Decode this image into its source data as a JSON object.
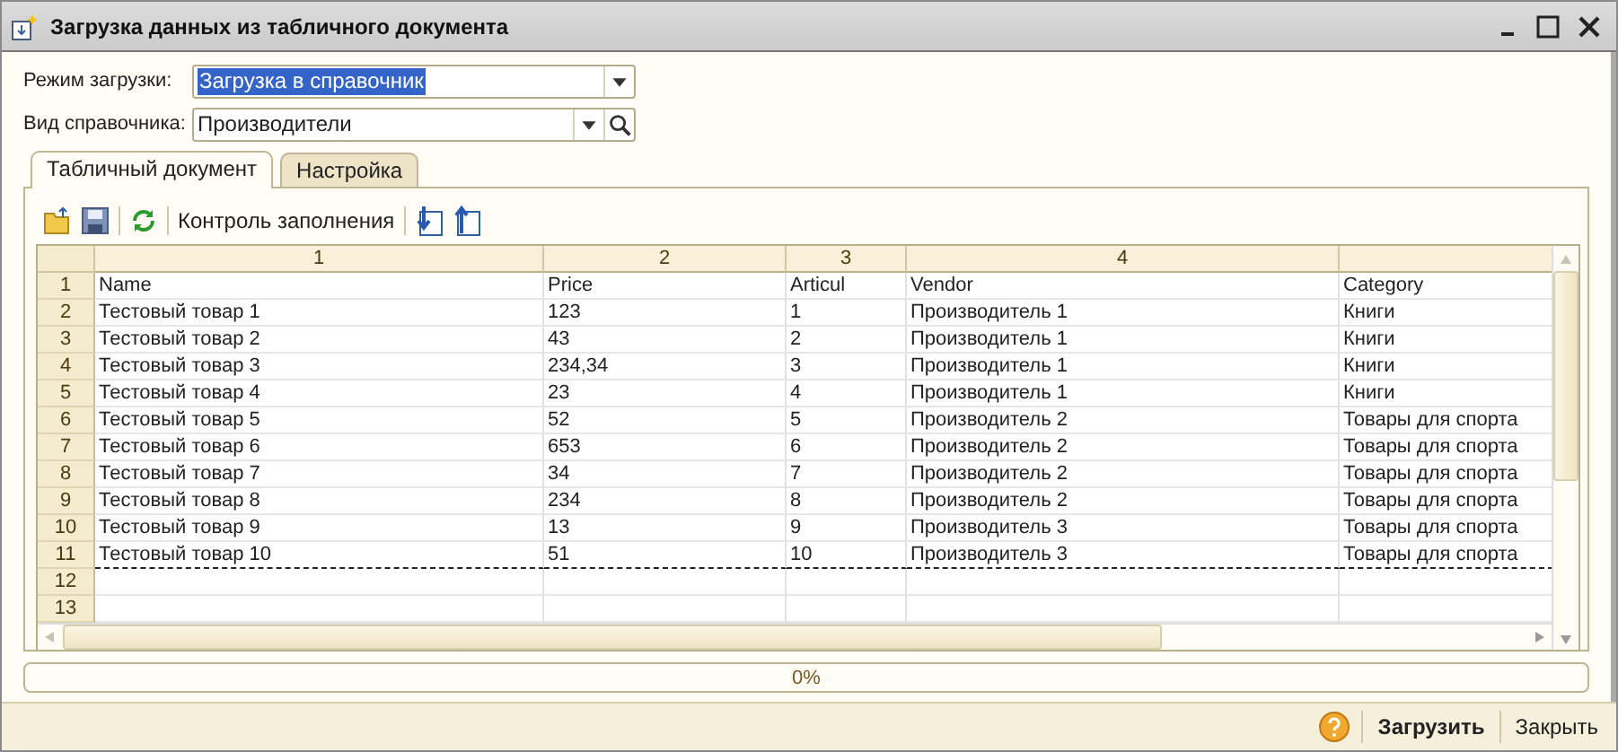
{
  "window": {
    "title": "Загрузка данных из табличного документа"
  },
  "fields": [
    {
      "label": "Режим загрузки:",
      "value": "Загрузка в справочник",
      "text_selected": true,
      "search": false
    },
    {
      "label": "Вид справочника:",
      "value": "Производители",
      "text_selected": false,
      "search": true
    }
  ],
  "tabs": [
    {
      "label": "Табличный документ",
      "selected": true
    },
    {
      "label": "Настройка",
      "selected": false
    }
  ],
  "toolbar": [
    {
      "kind": "open"
    },
    {
      "kind": "save"
    },
    {
      "kind": "separator"
    },
    {
      "kind": "refresh"
    },
    {
      "kind": "separator"
    },
    {
      "kind": "text",
      "label": "Контроль заполнения"
    },
    {
      "kind": "separator"
    },
    {
      "kind": "down"
    },
    {
      "kind": "up"
    }
  ],
  "sheet": {
    "columns": [
      "1",
      "2",
      "3",
      "4"
    ],
    "rows": [
      {
        "number": "1",
        "cells": [
          "Name",
          "Price",
          "Articul",
          "Vendor",
          "Category"
        ]
      },
      {
        "number": "2",
        "cells": [
          "Тестовый товар 1",
          "123",
          "1",
          "Производитель 1",
          "Книги"
        ]
      },
      {
        "number": "3",
        "cells": [
          "Тестовый товар 2",
          "43",
          "2",
          "Производитель 1",
          "Книги"
        ]
      },
      {
        "number": "4",
        "cells": [
          "Тестовый товар 3",
          "234,34",
          "3",
          "Производитель 1",
          "Книги"
        ]
      },
      {
        "number": "5",
        "cells": [
          "Тестовый товар 4",
          "23",
          "4",
          "Производитель 1",
          "Книги"
        ]
      },
      {
        "number": "6",
        "cells": [
          "Тестовый товар 5",
          "52",
          "5",
          "Производитель 2",
          "Товары для спорта"
        ]
      },
      {
        "number": "7",
        "cells": [
          "Тестовый товар 6",
          "653",
          "6",
          "Производитель 2",
          "Товары для спорта"
        ]
      },
      {
        "number": "8",
        "cells": [
          "Тестовый товар 7",
          "34",
          "7",
          "Производитель 2",
          "Товары для спорта"
        ]
      },
      {
        "number": "9",
        "cells": [
          "Тестовый товар 8",
          "234",
          "8",
          "Производитель 2",
          "Товары для спорта"
        ]
      },
      {
        "number": "10",
        "cells": [
          "Тестовый товар 9",
          "13",
          "9",
          "Производитель 3",
          "Товары для спорта"
        ]
      },
      {
        "number": "11",
        "cells": [
          "Тестовый товар 10",
          "51",
          "10",
          "Производитель 3",
          "Товары для спорта"
        ]
      },
      {
        "number": "12"
      },
      {
        "number": "13"
      }
    ]
  },
  "progress": {
    "level": 0,
    "reading": "0%"
  },
  "buttons": [
    {
      "label": "Загрузить",
      "default": true
    },
    {
      "label": "Закрыть",
      "default": false
    }
  ]
}
